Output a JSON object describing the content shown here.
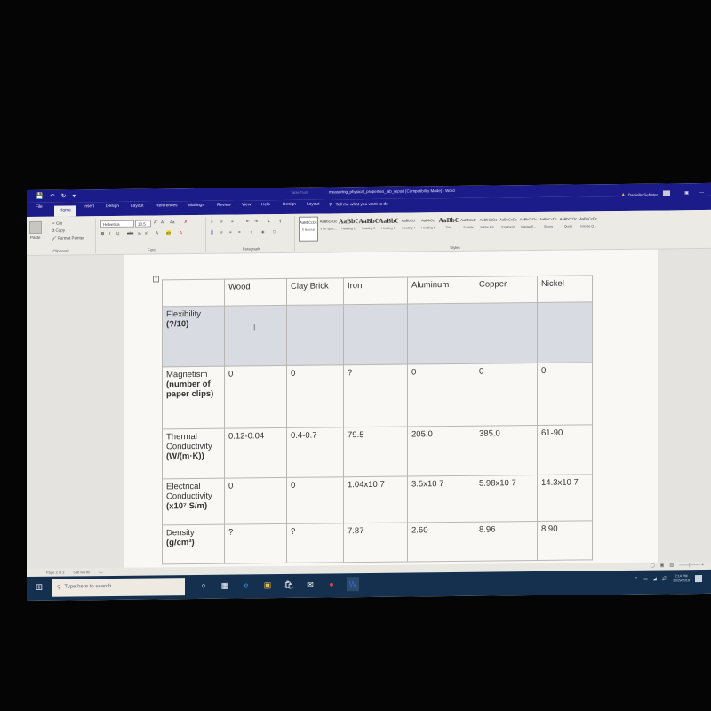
{
  "window": {
    "table_tools_label": "Table Tools",
    "title": "measuring_physical_properties_lab_report [Compatibility Mode] - Word",
    "user_name": "Danielle Sebater",
    "qat": {
      "save_icon": "save-icon",
      "undo_icon": "undo-icon",
      "redo_icon": "redo-icon",
      "customize_icon": "customize-icon"
    }
  },
  "tabs": [
    {
      "label": "File"
    },
    {
      "label": "Home",
      "active": true
    },
    {
      "label": "Insert"
    },
    {
      "label": "Design"
    },
    {
      "label": "Layout"
    },
    {
      "label": "References"
    },
    {
      "label": "Mailings"
    },
    {
      "label": "Review"
    },
    {
      "label": "View"
    },
    {
      "label": "Help"
    },
    {
      "label": "Design"
    },
    {
      "label": "Layout"
    }
  ],
  "tell_me": "Tell me what you want to do",
  "ribbon": {
    "clipboard": {
      "paste": "Paste",
      "cut": "Cut",
      "copy": "Copy",
      "format_painter": "Format Painter",
      "label": "Clipboard"
    },
    "font": {
      "family": "Helvetica",
      "size": "10.5",
      "label": "Font",
      "change_case": "Aa"
    },
    "paragraph": {
      "label": "Paragraph"
    },
    "styles": {
      "label": "Styles",
      "items": [
        {
          "preview": "AaBbCcDc",
          "name": "¶ Normal",
          "selected": true
        },
        {
          "preview": "AaBbCcDc",
          "name": "¶ No Spac..."
        },
        {
          "preview": "AaBbC",
          "name": "Heading 1",
          "big": true
        },
        {
          "preview": "AaBbC",
          "name": "Heading 2",
          "big": true
        },
        {
          "preview": "AaBbC",
          "name": "Heading 3",
          "big": true
        },
        {
          "preview": "AaBbCcl",
          "name": "Heading 4"
        },
        {
          "preview": "AaBbCcl",
          "name": "Heading 5"
        },
        {
          "preview": "AaBbC",
          "name": "Title",
          "big": true
        },
        {
          "preview": "AaBbCcD",
          "name": "Subtitle"
        },
        {
          "preview": "AaBbCcDc",
          "name": "Subtle Em..."
        },
        {
          "preview": "AaBbCcDc",
          "name": "Emphasis"
        },
        {
          "preview": "AaBbCcDc",
          "name": "Intense E..."
        },
        {
          "preview": "AaBbCcDc",
          "name": "Strong"
        },
        {
          "preview": "AaBbCcDc",
          "name": "Quote"
        },
        {
          "preview": "AaBbCcDc",
          "name": "Intense Q..."
        }
      ]
    }
  },
  "table": {
    "headers": [
      "",
      "Wood",
      "Clay Brick",
      "Iron",
      "Aluminum",
      "Copper",
      "Nickel"
    ],
    "rows": [
      {
        "label": "Flexibility",
        "unit": "(?/10)",
        "values": [
          "",
          "",
          "",
          "",
          "",
          ""
        ],
        "shaded": true
      },
      {
        "label": "Magnetism",
        "unit": "(number of paper clips)",
        "values": [
          "0",
          "0",
          "?",
          "0",
          "0",
          "0"
        ]
      },
      {
        "label": "Thermal Conductivity",
        "unit": "(W/(m·K))",
        "values": [
          "0.12-0.04",
          "0.4-0.7",
          "79.5",
          "205.0",
          "385.0",
          "61-90"
        ]
      },
      {
        "label": "Electrical Conductivity",
        "unit": "(x10⁷ S/m)",
        "values": [
          "0",
          "0",
          "1.04x10 7",
          "3.5x10 7",
          "5.98x10 7",
          "14.3x10 7"
        ]
      },
      {
        "label": "Density",
        "unit": "(g/cm³)",
        "values": [
          "?",
          "?",
          "7.87",
          "2.60",
          "8.96",
          "8.90"
        ]
      }
    ]
  },
  "status": {
    "page": "Page 2 of 2",
    "words": "538 words"
  },
  "taskbar": {
    "search_placeholder": "Type here to search",
    "time": "2:14 PM",
    "date": "10/29/2019"
  }
}
